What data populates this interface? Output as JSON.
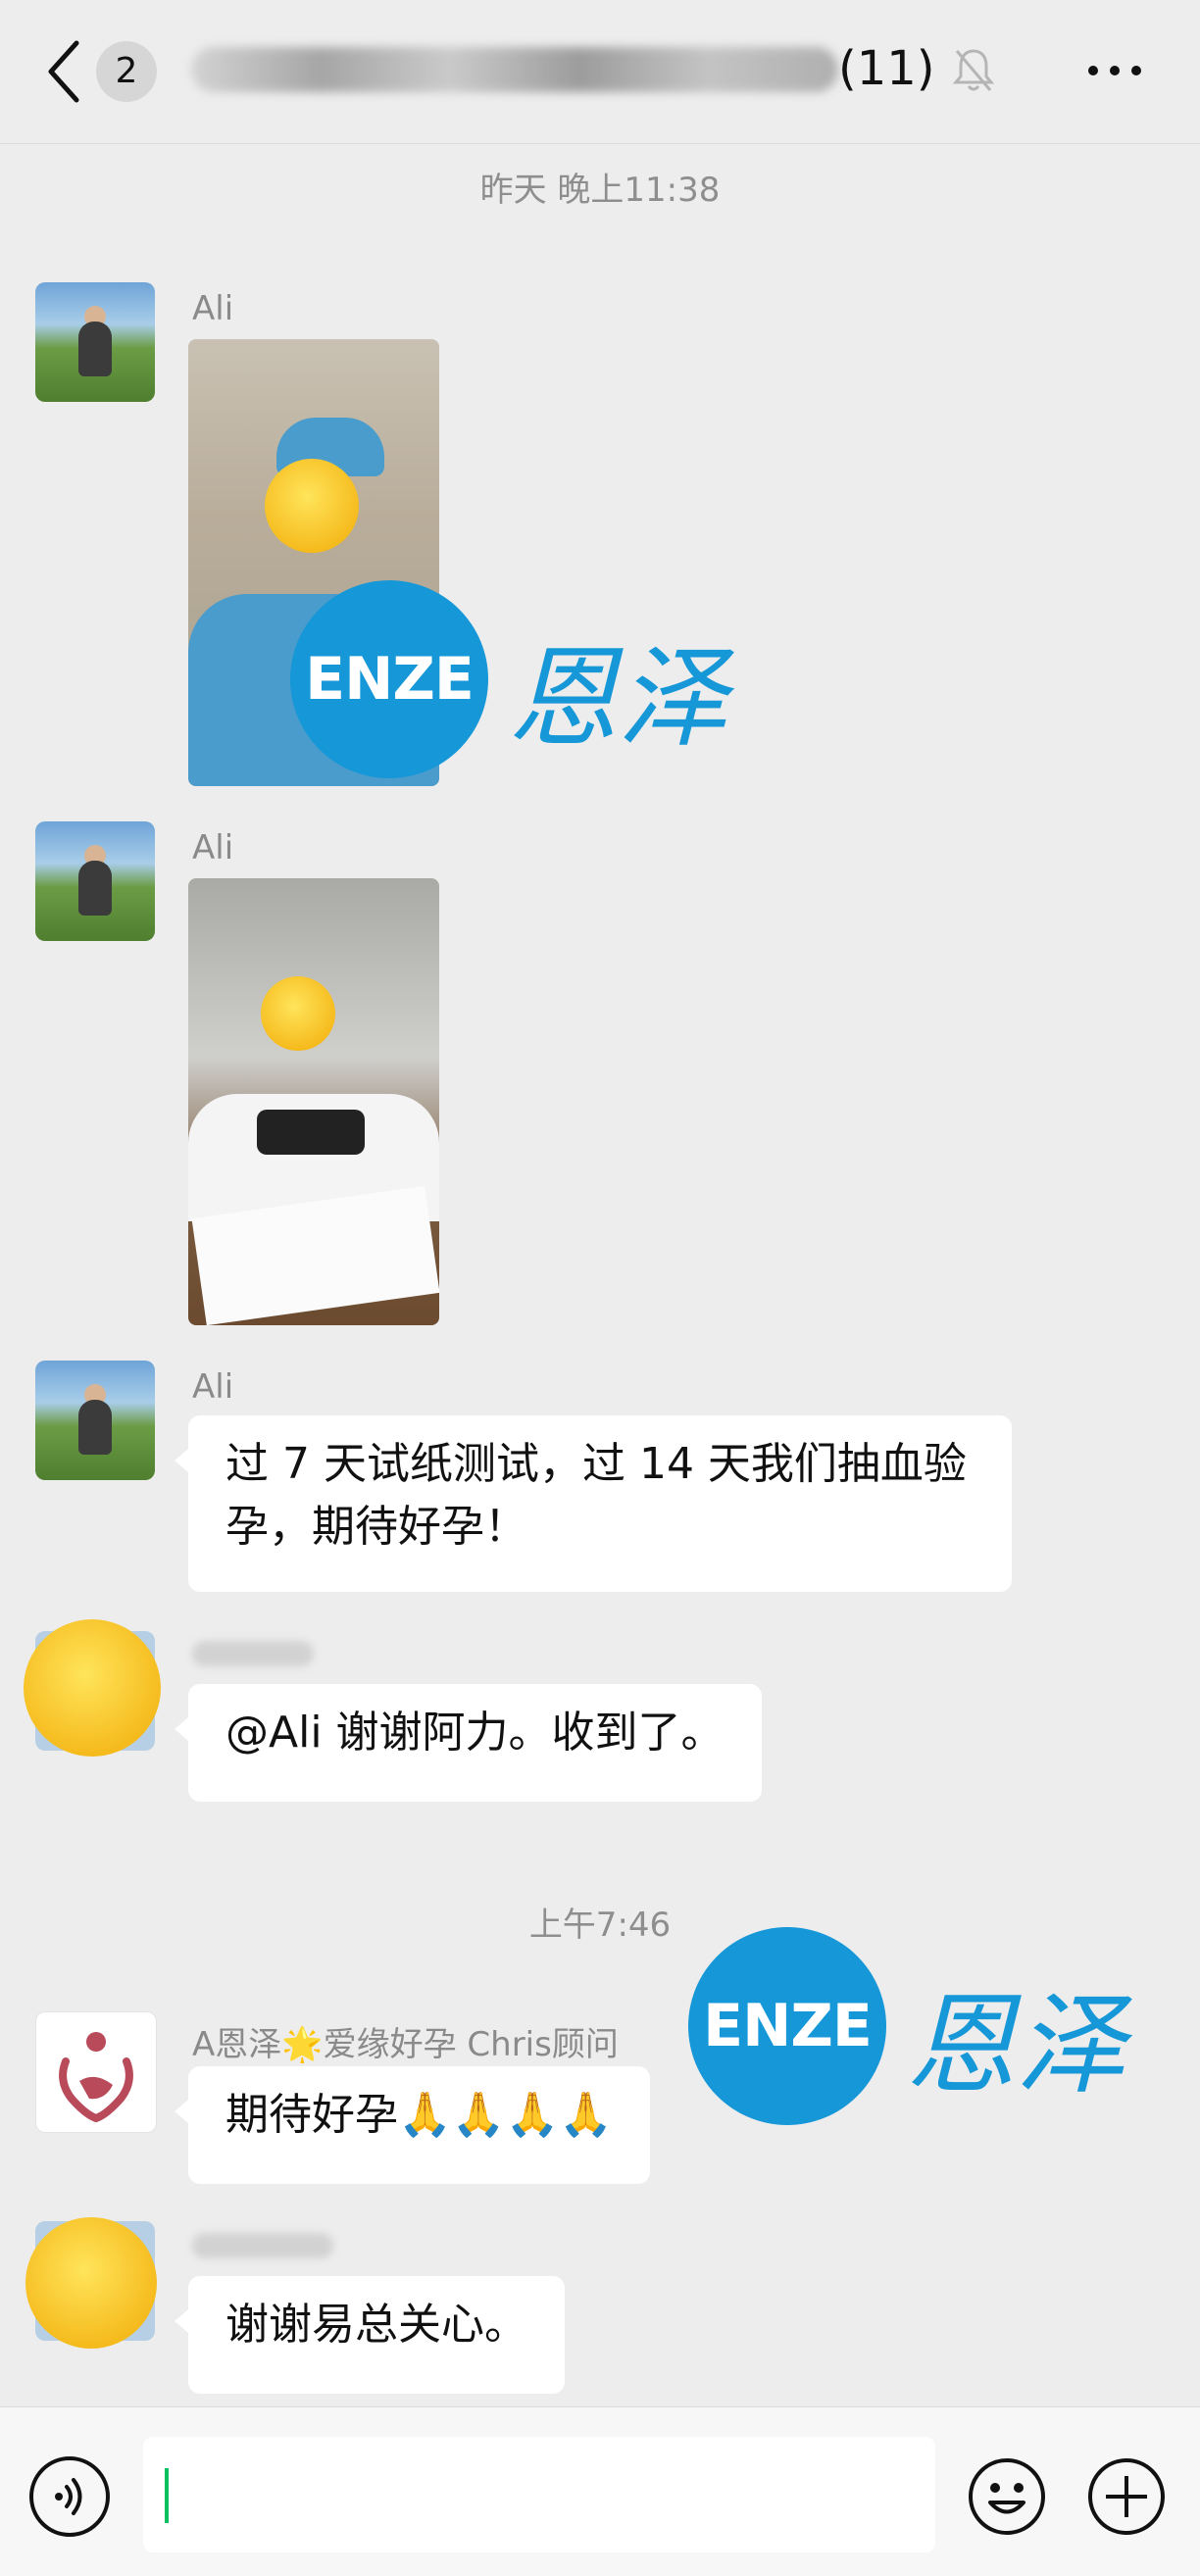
{
  "header": {
    "unread_count": "2",
    "member_count": "(11)"
  },
  "messages": {
    "time1": "昨天 晚上11:38",
    "sender_ali": "Ali",
    "msg3_text": "过 7 天试纸测试，过 14 天我们抽血验孕，期待好孕！",
    "msg4_text": "@Ali  谢谢阿力。收到了。",
    "time2": "上午7:46",
    "sender_chris": "A恩泽🌟爱缘好孕 Chris顾问",
    "msg5_text": "期待好孕🙏🙏🙏🙏",
    "msg6_text": "谢谢易总关心。"
  },
  "watermark": {
    "en": "ENZE",
    "cn": "恩泽"
  },
  "colors": {
    "accent_blue": "#1597d8",
    "caret_green": "#07c160",
    "background": "#ededed"
  },
  "icons": [
    "back-chevron-icon",
    "mute-bell-icon",
    "more-dots-icon",
    "voice-icon",
    "emoji-icon",
    "plus-icon"
  ]
}
